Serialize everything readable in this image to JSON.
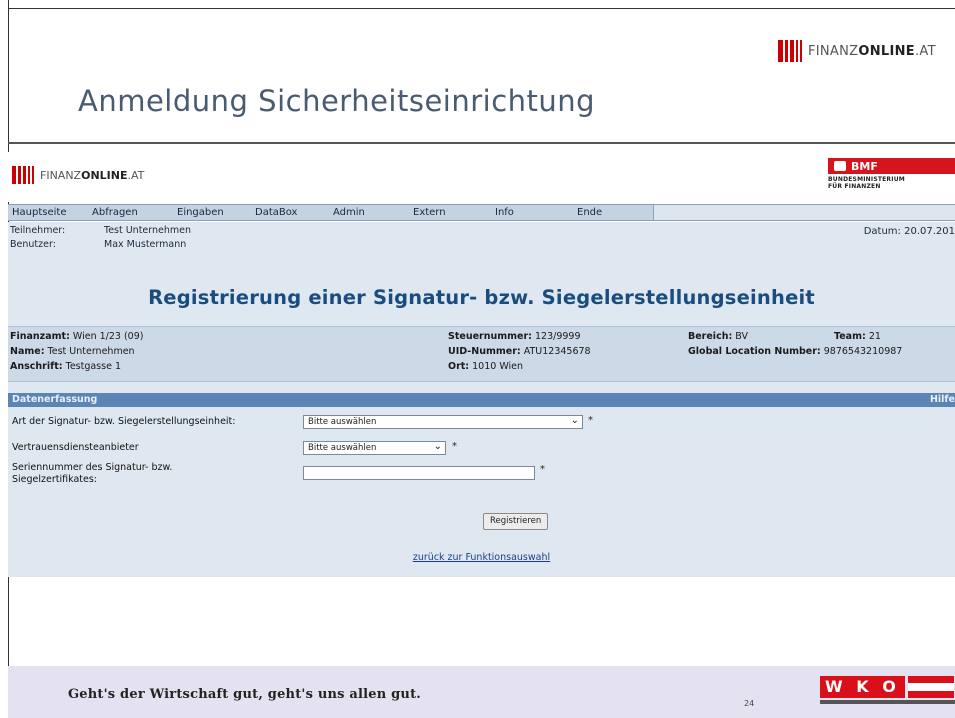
{
  "slide": {
    "brand_light": "FINANZ",
    "brand_bold": "ONLINE",
    "brand_suffix": ".AT",
    "title": "Anmeldung Sicherheitseinrichtung",
    "page_number": "24",
    "slogan": "Geht's der Wirtschaft gut, geht's uns allen gut.",
    "wko_text": "W K O"
  },
  "app": {
    "logo_light": "FINANZ",
    "logo_bold": "ONLINE",
    "logo_suffix": ".AT",
    "bmf_label": "BMF",
    "bmf_sub_line1": "BUNDESMINISTERIUM",
    "bmf_sub_line2": "FÜR FINANZEN",
    "nav": [
      "Hauptseite",
      "Abfragen",
      "Eingaben",
      "DataBox",
      "Admin",
      "Extern",
      "Info",
      "Ende"
    ],
    "teilnehmer_label": "Teilnehmer:",
    "teilnehmer_value": "Test Unternehmen",
    "benutzer_label": "Benutzer:",
    "benutzer_value": "Max Mustermann",
    "datum": "Datum: 20.07.201",
    "heading": "Registrierung einer Signatur- bzw. Siegelerstellungseinheit",
    "stamm": {
      "finanzamt_label": "Finanzamt:",
      "finanzamt_value": "Wien 1/23  (09)",
      "name_label": "Name:",
      "name_value": "Test Unternehmen",
      "anschrift_label": "Anschrift:",
      "anschrift_value": "Testgasse 1",
      "steuernummer_label": "Steuernummer:",
      "steuernummer_value": "123/9999",
      "uid_label": "UID-Nummer:",
      "uid_value": "ATU12345678",
      "ort_label": "Ort:",
      "ort_value": "1010 Wien",
      "bereich_label": "Bereich:",
      "bereich_value": "BV",
      "team_label": "Team:",
      "team_value": "21",
      "gln_label": "Global Location Number:",
      "gln_value": "9876543210987"
    },
    "section_title": "Datenerfassung",
    "section_help": "Hilfe",
    "form": {
      "art_label": "Art der Signatur- bzw. Siegelerstellungseinheit:",
      "art_value": "Bitte auswählen",
      "vda_label": "Vertrauensdiensteanbieter",
      "vda_value": "Bitte auswählen",
      "serien_label_1": "Seriennummer des Signatur- bzw.",
      "serien_label_2": "Siegelzertifikates:",
      "serien_value": "",
      "required_mark": "*"
    },
    "register_button": "Registrieren",
    "back_link": "zurück zur Funktionsauswahl"
  },
  "colors": {
    "brand_red": "#cc0000",
    "heading_blue": "#1a4c80",
    "section_blue": "#5b85b5",
    "panel_bg": "#dfe8f1"
  }
}
